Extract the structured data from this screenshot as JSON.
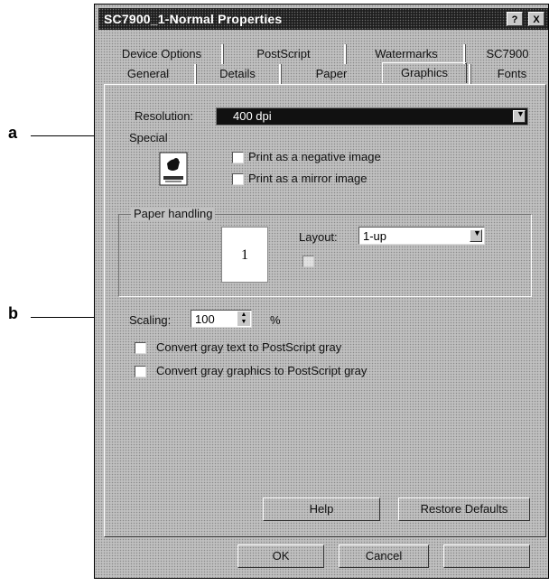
{
  "window": {
    "title": "SC7900_1-Normal Properties",
    "help_btn": "?",
    "close_btn": "X"
  },
  "tabs_back": [
    {
      "label": "Device Options"
    },
    {
      "label": "PostScript"
    },
    {
      "label": "Watermarks"
    },
    {
      "label": "SC7900"
    }
  ],
  "tabs_front": [
    {
      "label": "General"
    },
    {
      "label": "Details"
    },
    {
      "label": "Paper"
    },
    {
      "label": "Graphics",
      "selected": true
    },
    {
      "label": "Fonts"
    }
  ],
  "graphics": {
    "resolution_label": "Resolution:",
    "resolution_value": "400 dpi",
    "special_label": "Special",
    "negative_image_label": "Print as a negative image",
    "mirror_image_label": "Print as a mirror image",
    "paper_handling_label": "Paper handling",
    "layout_label": "Layout:",
    "layout_value": "1-up",
    "page_number": "1",
    "scaling_label": "Scaling:",
    "scaling_value": "100",
    "scaling_unit": "%",
    "convert_text_label": "Convert gray text to PostScript gray",
    "convert_graphics_label": "Convert gray graphics to PostScript gray",
    "help_button": "Help",
    "restore_button": "Restore Defaults"
  },
  "footer": {
    "ok": "OK",
    "cancel": "Cancel"
  },
  "callouts": {
    "a": "a",
    "b": "b"
  }
}
